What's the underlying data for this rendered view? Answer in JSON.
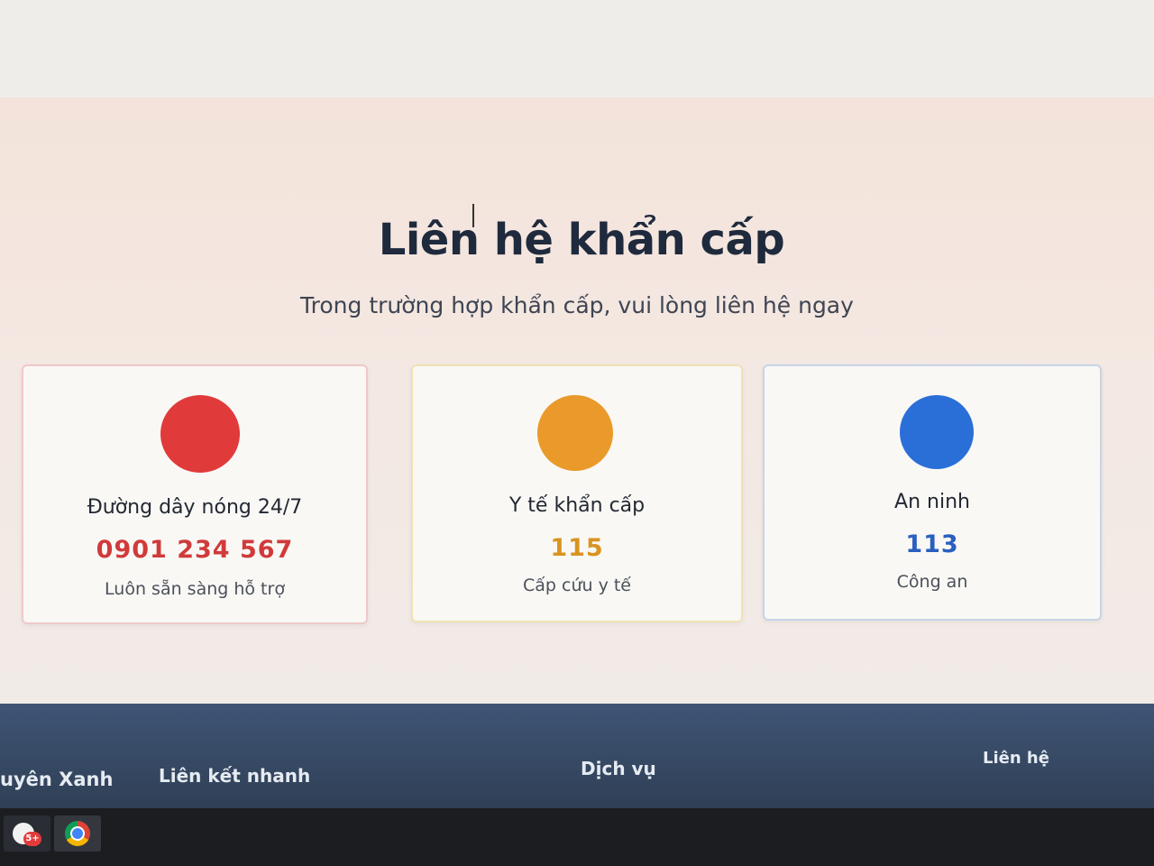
{
  "page": {
    "title": "Liên hệ khẩn cấp",
    "subtitle": "Trong trường hợp khẩn cấp, vui lòng liên hệ ngay"
  },
  "contacts": [
    {
      "title": "Đường dây nóng 24/7",
      "number": "0901 234 567",
      "description": "Luôn sẵn sàng hỗ trợ",
      "color": "#e03a3a"
    },
    {
      "title": "Y tế khẩn cấp",
      "number": "115",
      "description": "Cấp cứu y tế",
      "color": "#ea9a2a"
    },
    {
      "title": "An ninh",
      "number": "113",
      "description": "Công an",
      "color": "#2a6fd8"
    }
  ],
  "footer": {
    "brand": "uyên Xanh",
    "quick_links": "Liên kết nhanh",
    "services": "Dịch vụ",
    "contact": "Liên hệ"
  },
  "taskbar": {
    "zalo_badge": "5+"
  }
}
